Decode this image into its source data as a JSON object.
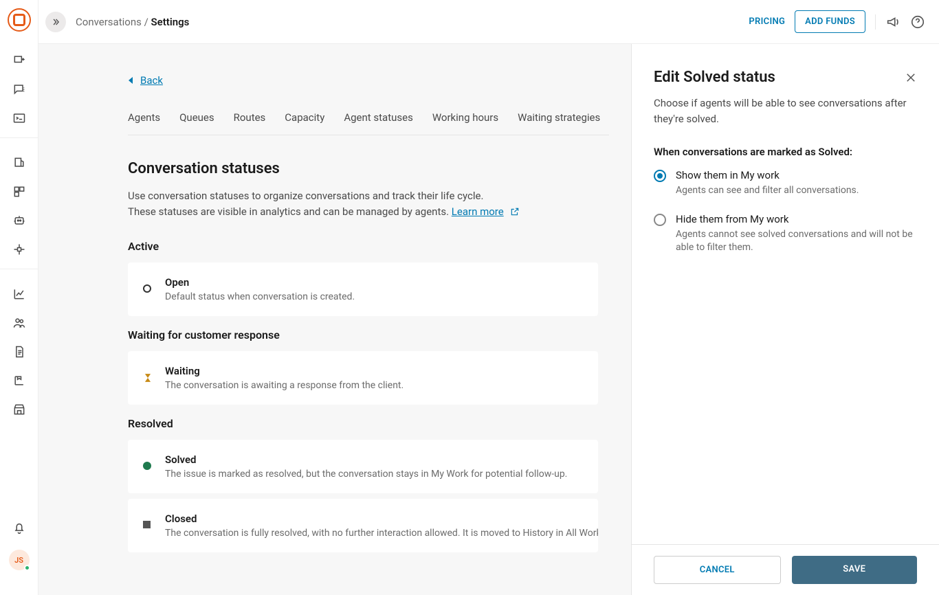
{
  "header": {
    "breadcrumb_parent": "Conversations",
    "breadcrumb_current": "Settings",
    "pricing_label": "PRICING",
    "add_funds_label": "ADD FUNDS"
  },
  "rail": {
    "avatar_initials": "JS"
  },
  "back_label": "Back",
  "tabs": [
    "Agents",
    "Queues",
    "Routes",
    "Capacity",
    "Agent statuses",
    "Working hours",
    "Waiting strategies"
  ],
  "section": {
    "title": "Conversation statuses",
    "desc_line1": "Use conversation statuses to organize conversations and track their life cycle.",
    "desc_line2": "These statuses are visible in analytics and can be managed by agents.",
    "learn_more": "Learn more"
  },
  "groups": [
    {
      "title": "Active",
      "items": [
        {
          "icon": "open",
          "name": "Open",
          "desc": "Default status when conversation is created."
        }
      ]
    },
    {
      "title": "Waiting for customer response",
      "items": [
        {
          "icon": "waiting",
          "name": "Waiting",
          "desc": "The conversation is awaiting a response from the client."
        }
      ]
    },
    {
      "title": "Resolved",
      "items": [
        {
          "icon": "solved",
          "name": "Solved",
          "desc": "The issue is marked as resolved, but the conversation stays in My Work for potential follow-up."
        },
        {
          "icon": "closed",
          "name": "Closed",
          "desc": "The conversation is fully resolved, with no further interaction allowed. It is moved to History in All Work."
        }
      ]
    }
  ],
  "panel": {
    "title": "Edit Solved status",
    "desc": "Choose if agents will be able to see conversations after they're solved.",
    "subhead": "When conversations are marked as Solved:",
    "options": [
      {
        "label": "Show them in My work",
        "desc": "Agents can see and filter all conversations.",
        "selected": true
      },
      {
        "label": "Hide them from My work",
        "desc": "Agents cannot see solved conversations and will not be able to filter them.",
        "selected": false
      }
    ],
    "cancel_label": "CANCEL",
    "save_label": "SAVE"
  }
}
